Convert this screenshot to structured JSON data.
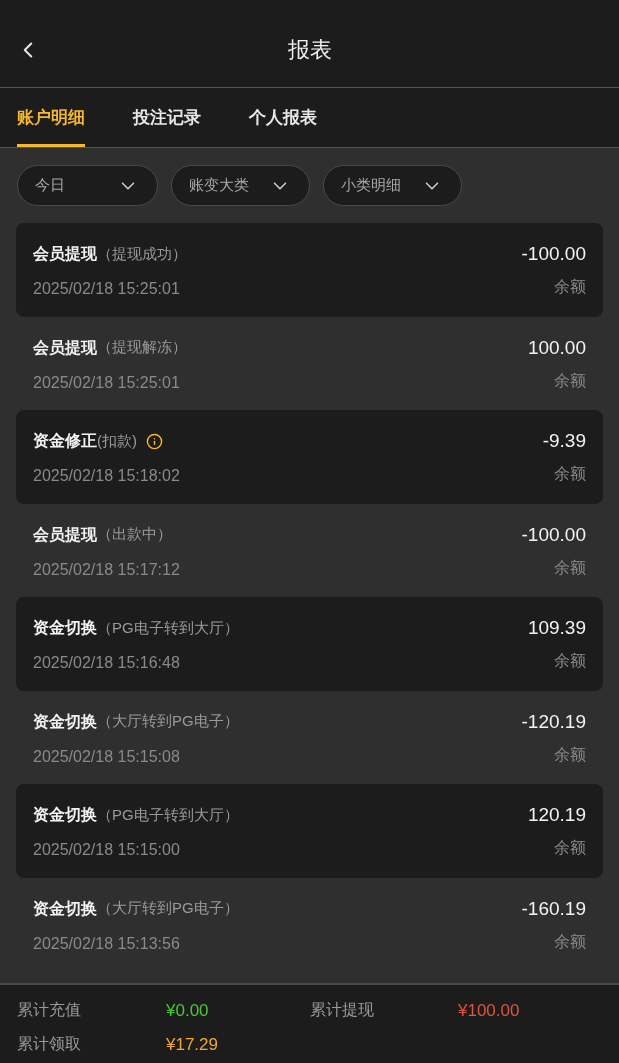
{
  "header": {
    "title": "报表"
  },
  "tabs": [
    {
      "label": "账户明细",
      "selected": true
    },
    {
      "label": "投注记录",
      "selected": false
    },
    {
      "label": "个人报表",
      "selected": false
    }
  ],
  "filters": [
    {
      "label": "今日"
    },
    {
      "label": "账变大类"
    },
    {
      "label": "小类明细"
    }
  ],
  "records": [
    {
      "title": "会员提现",
      "detail": "（提现成功）",
      "time": "2025/02/18 15:25:01",
      "amount": "-100.00",
      "balance_label": "余额",
      "info": false
    },
    {
      "title": "会员提现",
      "detail": "（提现解冻）",
      "time": "2025/02/18 15:25:01",
      "amount": "100.00",
      "balance_label": "余额",
      "info": false
    },
    {
      "title": "资金修正",
      "detail": "(扣款)",
      "time": "2025/02/18 15:18:02",
      "amount": "-9.39",
      "balance_label": "余额",
      "info": true
    },
    {
      "title": "会员提现",
      "detail": "（出款中）",
      "time": "2025/02/18 15:17:12",
      "amount": "-100.00",
      "balance_label": "余额",
      "info": false
    },
    {
      "title": "资金切换",
      "detail": "（PG电子转到大厅）",
      "time": "2025/02/18 15:16:48",
      "amount": "109.39",
      "balance_label": "余额",
      "info": false
    },
    {
      "title": "资金切换",
      "detail": "（大厅转到PG电子）",
      "time": "2025/02/18 15:15:08",
      "amount": "-120.19",
      "balance_label": "余额",
      "info": false
    },
    {
      "title": "资金切换",
      "detail": "（PG电子转到大厅）",
      "time": "2025/02/18 15:15:00",
      "amount": "120.19",
      "balance_label": "余额",
      "info": false
    },
    {
      "title": "资金切换",
      "detail": "（大厅转到PG电子）",
      "time": "2025/02/18 15:13:56",
      "amount": "-160.19",
      "balance_label": "余额",
      "info": false
    }
  ],
  "summary": [
    {
      "label": "累计充值",
      "value": "¥0.00",
      "color": "#4cc43a"
    },
    {
      "label": "累计提现",
      "value": "¥100.00",
      "color": "#e0533f"
    },
    {
      "label": "累计领取",
      "value": "¥17.29",
      "color": "#f2a933"
    }
  ]
}
